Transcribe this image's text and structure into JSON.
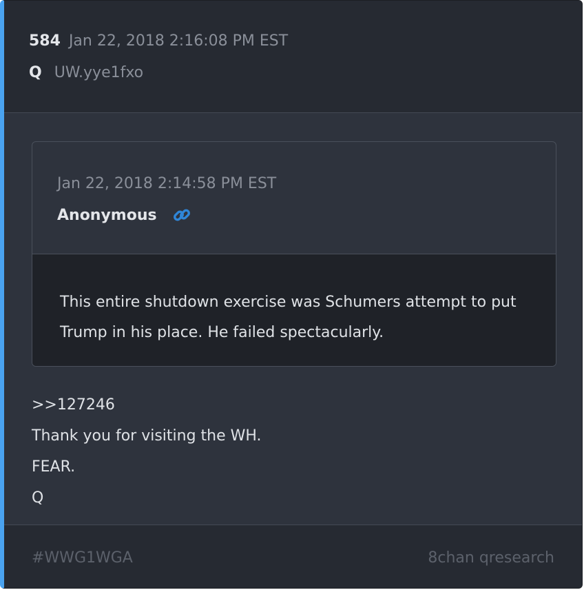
{
  "colors": {
    "accent_bar": "#4aa3f0",
    "card_bg": "#2e333d",
    "header_bg": "#262a32",
    "quote_body_bg": "#1f2228",
    "link_icon": "#2f86d8"
  },
  "post": {
    "number": "584",
    "date": "Jan 22, 2018 2:16:08 PM EST",
    "author": "Q",
    "tripcode": "UW.yye1fxo"
  },
  "quote": {
    "date": "Jan 22, 2018 2:14:58 PM EST",
    "author": "Anonymous",
    "link_icon": "link-icon",
    "text": "This entire shutdown exercise was Schumers attempt to put Trump in his place. He failed spectacularly."
  },
  "message": {
    "lines": [
      ">>127246",
      "Thank you for visiting the WH.",
      "FEAR.",
      "Q"
    ]
  },
  "footer": {
    "hashtag": "#WWG1WGA",
    "source": "8chan qresearch"
  }
}
